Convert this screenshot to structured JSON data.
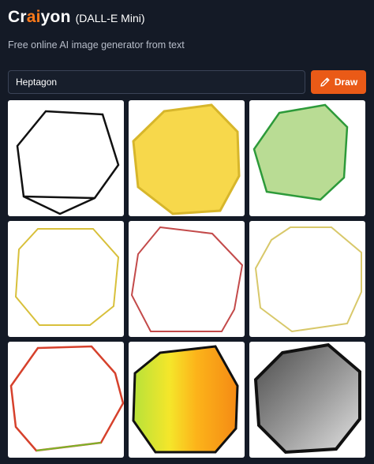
{
  "app": {
    "logo_pre": "Cr",
    "logo_accent": "ai",
    "logo_post": "yon",
    "tagline": "(DALL-E Mini)",
    "subtitle": "Free online AI image generator from text"
  },
  "prompt": {
    "value": "Heptagon"
  },
  "draw": {
    "label": "Draw",
    "icon": "pencil-icon",
    "color": "#ea5a17"
  },
  "colors": {
    "background": "#141a26",
    "accent": "#ff7a1a"
  },
  "results": [
    {
      "name": "result-image-1",
      "shape": "outline-heptagon",
      "stroke": "#111111",
      "fill": "none"
    },
    {
      "name": "result-image-2",
      "shape": "filled-polygon",
      "stroke": "#d7b62b",
      "fill": "#f7d84b"
    },
    {
      "name": "result-image-3",
      "shape": "filled-polygon",
      "stroke": "#2d9a3a",
      "fill": "#b9dc94"
    },
    {
      "name": "result-image-4",
      "shape": "outline-polygon",
      "stroke": "#d8c03b",
      "fill": "none"
    },
    {
      "name": "result-image-5",
      "shape": "outline-polygon",
      "stroke": "#c34a4a",
      "fill": "none"
    },
    {
      "name": "result-image-6",
      "shape": "outline-polygon",
      "stroke": "#d8c86a",
      "fill": "none"
    },
    {
      "name": "result-image-7",
      "shape": "outline-polygon",
      "stroke": "#d6412c",
      "fill": "none"
    },
    {
      "name": "result-image-8",
      "shape": "gradient-polygon",
      "stroke": "#111111",
      "fill": "yellow-orange gradient"
    },
    {
      "name": "result-image-9",
      "shape": "gradient-polygon",
      "stroke": "#111111",
      "fill": "grey gradient"
    }
  ]
}
